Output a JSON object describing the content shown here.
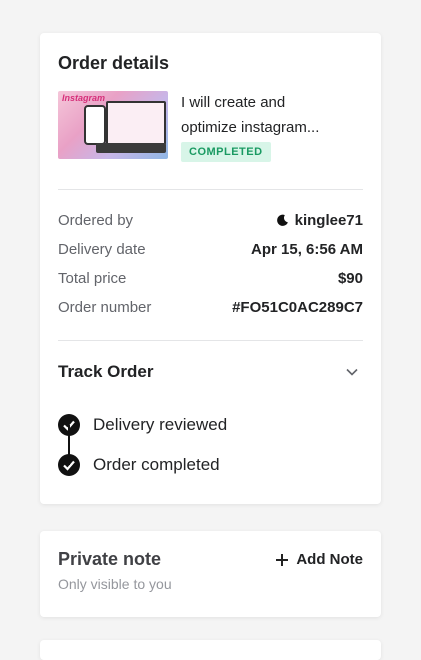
{
  "order": {
    "title": "Order details",
    "gig_title": "I will create and optimize instagram...",
    "thumb_text": "Instagram",
    "status": "COMPLETED",
    "details": [
      {
        "label": "Ordered by",
        "value": "kinglee71"
      },
      {
        "label": "Delivery date",
        "value": "Apr 15, 6:56 AM"
      },
      {
        "label": "Total price",
        "value": "$90"
      },
      {
        "label": "Order number",
        "value": "#FO51C0AC289C7"
      }
    ],
    "track": {
      "title": "Track Order",
      "steps": [
        "Delivery reviewed",
        "Order completed"
      ]
    }
  },
  "note": {
    "title": "Private note",
    "add_label": "Add Note",
    "subtitle": "Only visible to you"
  },
  "colors": {
    "status_bg": "#d8f5e8",
    "status_text": "#1a9a62",
    "background": "#f4f4f4"
  }
}
